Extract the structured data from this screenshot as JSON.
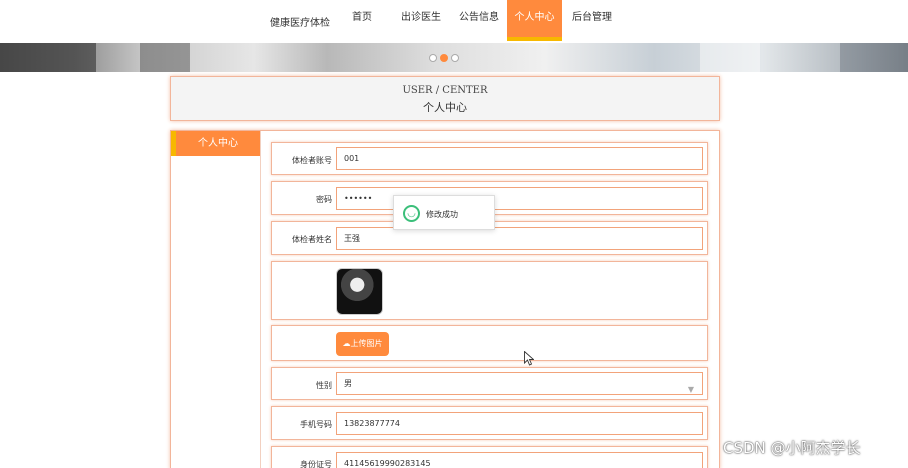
{
  "nav": {
    "brand": "健康医疗体检",
    "items": [
      {
        "label": "首页",
        "active": false
      },
      {
        "label": "出诊医生",
        "active": false
      },
      {
        "label": "公告信息",
        "active": false
      },
      {
        "label": "个人中心",
        "active": true
      },
      {
        "label": "后台管理",
        "active": false
      }
    ]
  },
  "banner": {
    "dots_active_index": 1,
    "dots_count": 3
  },
  "header": {
    "en": "USER / CENTER",
    "cn": "个人中心"
  },
  "sidebar": {
    "tab_label": "个人中心"
  },
  "form": {
    "account_label": "体检者账号",
    "account_value": "001",
    "password_label": "密码",
    "password_value": "••••••",
    "name_label": "体检者姓名",
    "name_value": "王强",
    "upload_label": "上传图片",
    "gender_label": "性别",
    "gender_value": "男",
    "phone_label": "手机号码",
    "phone_value": "13823877774",
    "idcard_label": "身份证号",
    "idcard_value": "41145619990283145"
  },
  "toast": {
    "message": "修改成功"
  },
  "watermark": "CSDN @小阿杰学长",
  "colors": {
    "accent": "#ff8a3d",
    "accent_border": "#f7b800",
    "success": "#3bbf7a"
  }
}
